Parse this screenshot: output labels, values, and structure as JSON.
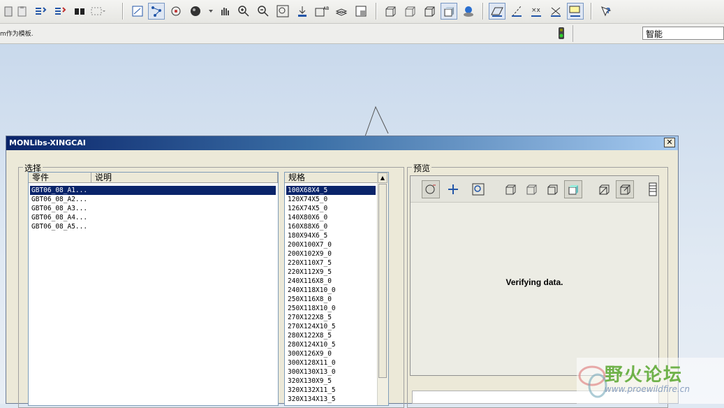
{
  "status": {
    "message": "m作为模板.",
    "smart_filter_value": "智能"
  },
  "dialog": {
    "title": "MONLibs-XINGCAI",
    "close_glyph": "✕",
    "select_group_label": "选择",
    "preview_group_label": "预览",
    "parts_table": {
      "columns": [
        "零件",
        "说明"
      ],
      "rows": [
        "GBT06_08_A1...",
        "GBT06_08_A2...",
        "GBT06_08_A3...",
        "GBT06_08_A4...",
        "GBT06_08_A5..."
      ],
      "selected_index": 0
    },
    "spec_list": {
      "header": "规格",
      "items": [
        "100X68X4_5",
        "120X74X5_0",
        "126X74X5_0",
        "140X80X6_0",
        "160X88X6_0",
        "180X94X6_5",
        "200X100X7_0",
        "200X102X9_0",
        "220X110X7_5",
        "220X112X9_5",
        "240X116X8_0",
        "240X118X10_0",
        "250X116X8_0",
        "250X118X10_0",
        "270X122X8_5",
        "270X124X10_5",
        "280X122X8_5",
        "280X124X10_5",
        "300X126X9_0",
        "300X128X11_0",
        "300X130X13_0",
        "320X130X9_5",
        "320X132X11_5",
        "320X134X13_5"
      ],
      "selected_index": 0
    },
    "preview_status": "Verifying data."
  },
  "watermark": {
    "text": "野火论坛",
    "url": "www.proewildfire.cn"
  },
  "colors": {
    "selection": "#0a246a",
    "dialog_bg": "#ece9d8",
    "canvas_top": "#c9d9ec"
  }
}
